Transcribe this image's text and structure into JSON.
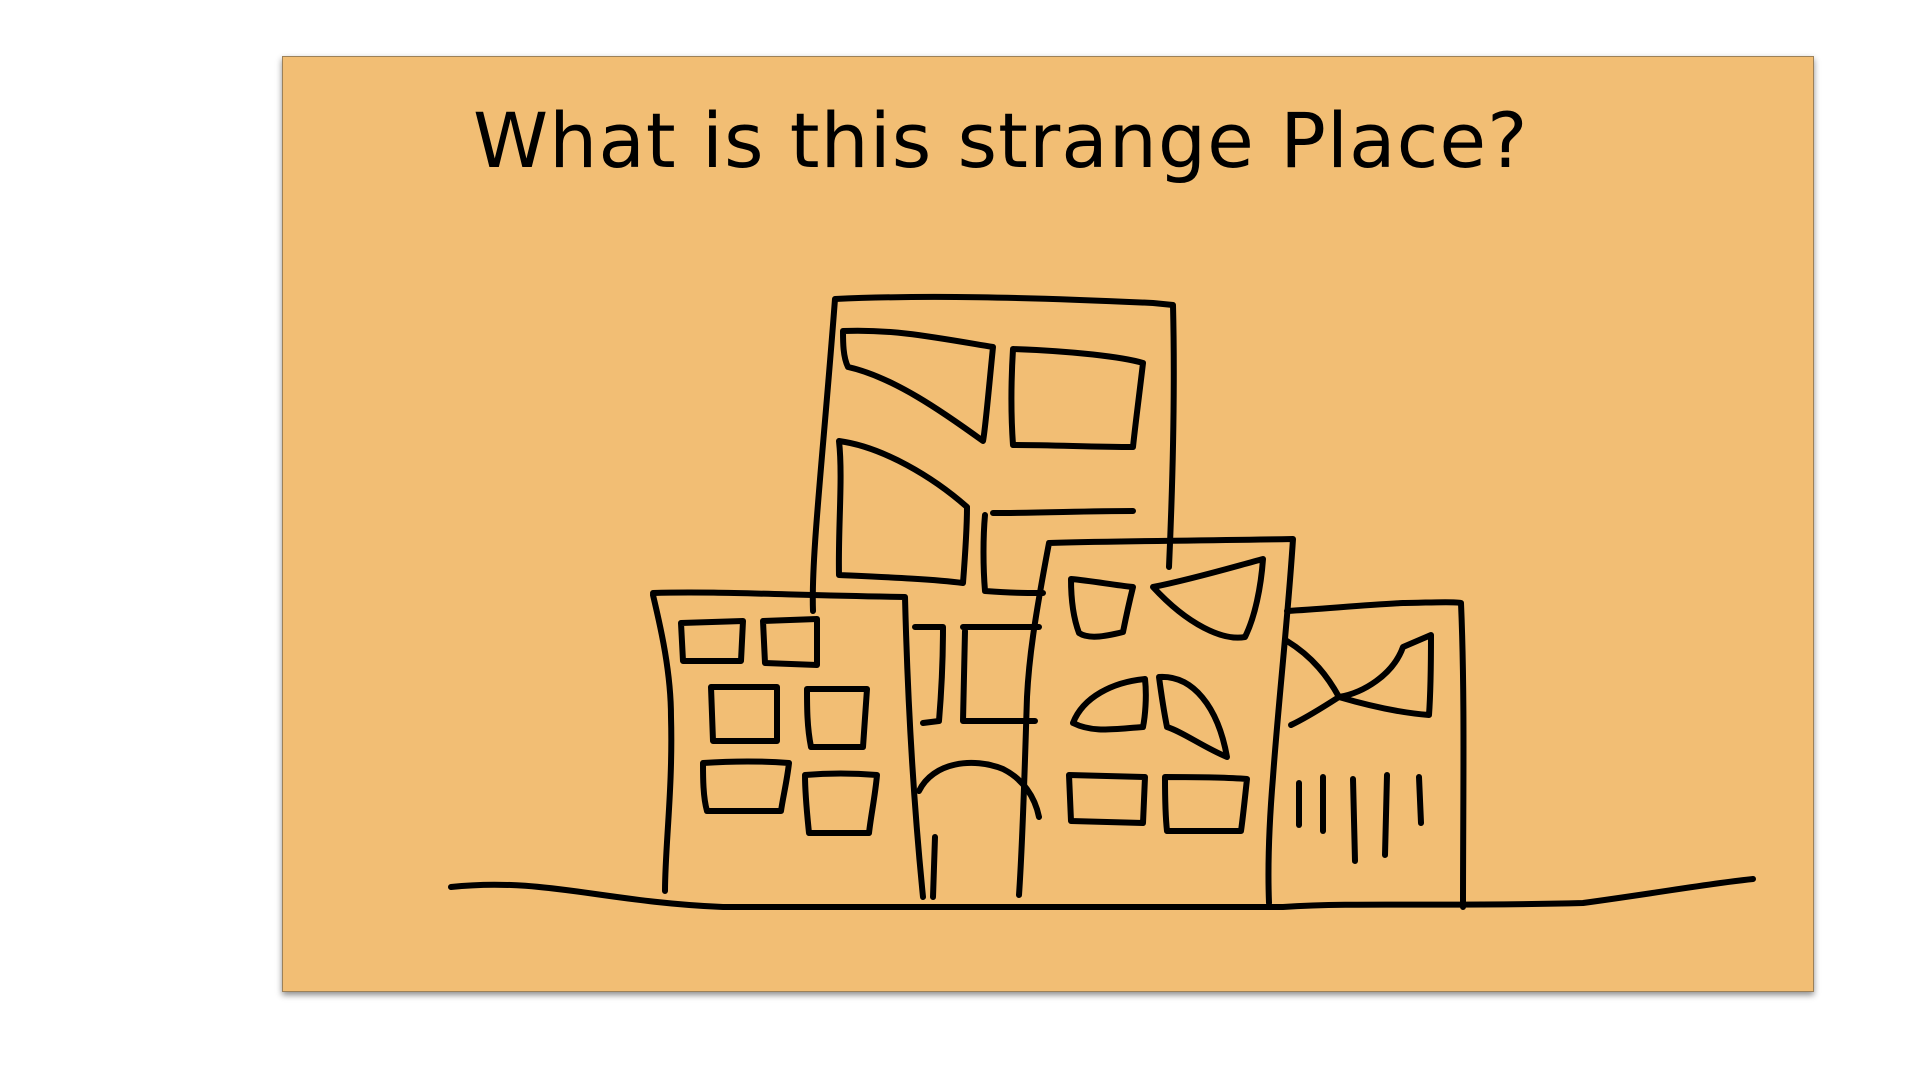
{
  "slide": {
    "title": "What is this strange Place?"
  },
  "colors": {
    "page_background": "#ffffff",
    "card_background": "#f2be74",
    "ink": "#000000"
  },
  "illustration": {
    "subject": "hand-drawn buildings with face-like windows"
  }
}
